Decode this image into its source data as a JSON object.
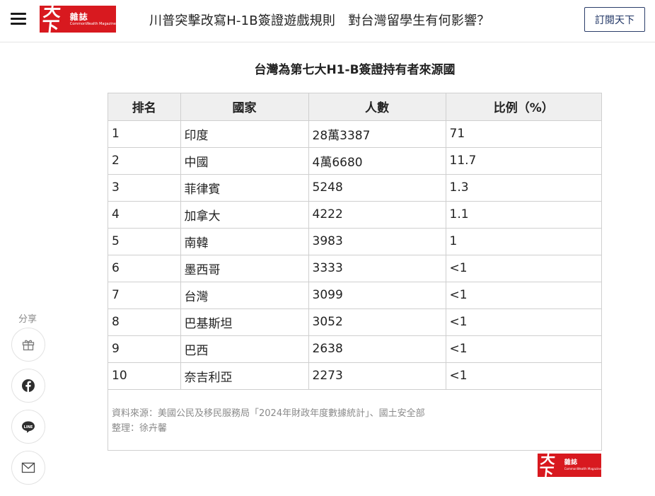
{
  "header": {
    "menu_icon": "hamburger-menu-icon",
    "logo": {
      "main": "天下",
      "sub": "雜誌",
      "en": "CommonWealth Magazine"
    },
    "article_title": "川普突擊改寫H-1B簽證遊戲規則　對台灣留學生有何影響？",
    "subscribe_label": "訂閱天下"
  },
  "table": {
    "title": "台灣為第七大H1-B簽證持有者來源國",
    "headers": [
      "排名",
      "國家",
      "人數",
      "比例（%）"
    ],
    "rows": [
      [
        "1",
        "印度",
        "28萬3387",
        "71"
      ],
      [
        "2",
        "中國",
        "4萬6680",
        "11.7"
      ],
      [
        "3",
        "菲律賓",
        "5248",
        "1.3"
      ],
      [
        "4",
        "加拿大",
        "4222",
        "1.1"
      ],
      [
        "5",
        "南韓",
        "3983",
        "1"
      ],
      [
        "6",
        "墨西哥",
        "3333",
        "<1"
      ],
      [
        "7",
        "台灣",
        "3099",
        "<1"
      ],
      [
        "8",
        "巴基斯坦",
        "3052",
        "<1"
      ],
      [
        "9",
        "巴西",
        "2638",
        "<1"
      ],
      [
        "10",
        "奈吉利亞",
        "2273",
        "<1"
      ]
    ],
    "source": "資料來源：美國公民及移民服務局「2024年財政年度數據統計」、國土安全部",
    "editor": "整理：徐卉馨",
    "footer_logo": {
      "main": "天下",
      "sub": "雜誌",
      "en": "CommonWealth Magazine"
    }
  },
  "share": {
    "label": "分享",
    "buttons": [
      {
        "icon": "gift-icon"
      },
      {
        "icon": "facebook-icon"
      },
      {
        "icon": "line-icon",
        "text": "LINE"
      },
      {
        "icon": "mail-icon"
      }
    ]
  },
  "colors": {
    "brand_red": "#d8191f",
    "subscribe_border": "#2b3e6a",
    "table_header_bg": "#efefef",
    "muted_text": "#8a8a8a"
  }
}
